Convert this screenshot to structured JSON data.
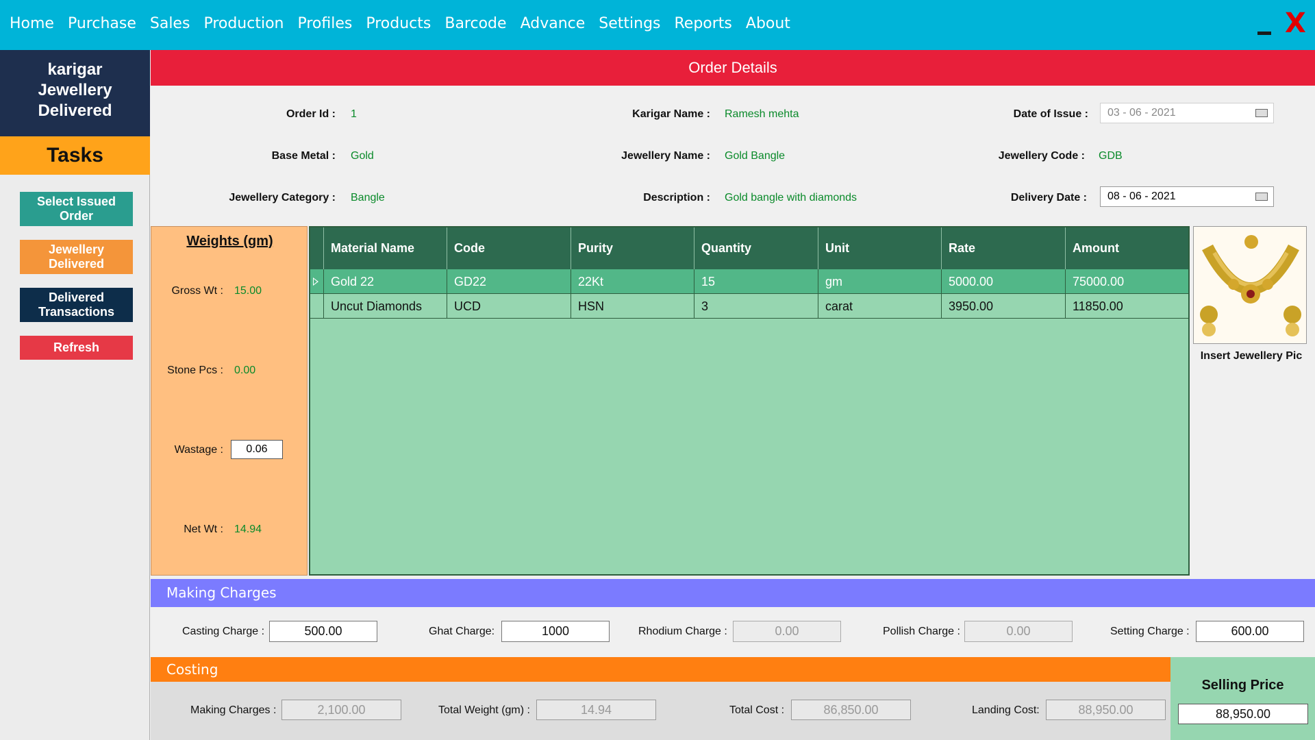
{
  "menu": [
    "Home",
    "Purchase",
    "Sales",
    "Production",
    "Profiles",
    "Products",
    "Barcode",
    "Advance",
    "Settings",
    "Reports",
    "About"
  ],
  "window": {
    "minimize_glyph": "_",
    "close_glyph": "X"
  },
  "sidebar": {
    "title_line1": "karigar",
    "title_line2": "Jewellery",
    "title_line3": "Delivered",
    "tasks_heading": "Tasks",
    "btn_select_l1": "Select Issued",
    "btn_select_l2": "Order",
    "btn_delivered_l1": "Jewellery",
    "btn_delivered_l2": "Delivered",
    "btn_trans_l1": "Delivered",
    "btn_trans_l2": "Transactions",
    "btn_refresh": "Refresh"
  },
  "order": {
    "heading": "Order Details",
    "order_id_label": "Order Id :",
    "order_id": "1",
    "karigar_label": "Karigar Name :",
    "karigar": "Ramesh mehta",
    "issue_label": "Date of Issue :",
    "issue_date": "03 - 06 - 2021",
    "base_metal_label": "Base Metal :",
    "base_metal": "Gold",
    "jname_label": "Jewellery Name :",
    "jname": "Gold Bangle",
    "jcode_label": "Jewellery Code :",
    "jcode": "GDB",
    "category_label": "Jewellery Category :",
    "category": "Bangle",
    "desc_label": "Description :",
    "desc": "Gold bangle with diamonds",
    "delivery_label": "Delivery Date :",
    "delivery_date": "08 - 06 - 2021"
  },
  "weights": {
    "title": "Weights (gm)",
    "gross_label": "Gross Wt :",
    "gross": "15.00",
    "stone_label": "Stone Pcs :",
    "stone": "0.00",
    "wastage_label": "Wastage :",
    "wastage": "0.06",
    "net_label": "Net Wt :",
    "net": "14.94"
  },
  "grid": {
    "columns": [
      "Material Name",
      "Code",
      "Purity",
      "Quantity",
      "Unit",
      "Rate",
      "Amount"
    ],
    "rows": [
      [
        "Gold 22",
        "GD22",
        "22Kt",
        "15",
        "gm",
        "5000.00",
        "75000.00"
      ],
      [
        "Uncut Diamonds",
        "UCD",
        "HSN",
        "3",
        "carat",
        "3950.00",
        "11850.00"
      ]
    ]
  },
  "picture": {
    "caption": "Insert Jewellery Pic",
    "icon": "jewellery-photo"
  },
  "making": {
    "heading": "Making Charges",
    "casting_label": "Casting Charge :",
    "casting": "500.00",
    "ghat_label": "Ghat Charge:",
    "ghat": "1000",
    "rhodium_label": "Rhodium Charge :",
    "rhodium": "0.00",
    "polish_label": "Pollish Charge :",
    "polish": "0.00",
    "setting_label": "Setting Charge :",
    "setting": "600.00"
  },
  "costing": {
    "heading": "Costing",
    "making_label": "Making Charges :",
    "making": "2,100.00",
    "weight_label": "Total Weight (gm) :",
    "weight": "14.94",
    "total_label": "Total Cost :",
    "total": "86,850.00",
    "landing_label": "Landing Cost:",
    "landing": "88,950.00",
    "selling_label": "Selling Price",
    "selling": "88,950.00"
  },
  "colors": {
    "menubar": "#00b4d8",
    "order_header": "#e81f3a",
    "grid_header": "#2d6a4f",
    "grid_body": "#96d6b0",
    "making_header": "#7b7bff",
    "costing_header": "#ff7f11"
  }
}
